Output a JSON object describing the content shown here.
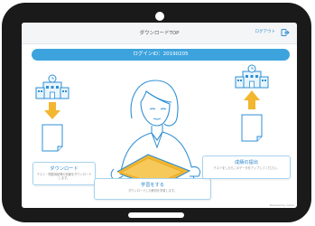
{
  "app": {
    "title": "ダウンロードTOP",
    "logout_label": "ログアウト"
  },
  "login": {
    "label": "ログインID：20190205"
  },
  "cards": {
    "download": {
      "title": "ダウンロード",
      "desc": "テスト・問題用紙等の情報をダウンロードします。"
    },
    "study": {
      "title": "学習をする",
      "desc": "ダウンロードした教材を学習します。"
    },
    "submit": {
      "title": "成績の提出",
      "desc": "テストをしたらこのデータをアップしてください。"
    }
  },
  "footer": {
    "mark": "Powered by xxxxx"
  },
  "colors": {
    "accent": "#3da3dd",
    "arrow": "#f3b62f",
    "line_art": "#2f8fd4",
    "tablet_frame": "#1a1a1a"
  }
}
